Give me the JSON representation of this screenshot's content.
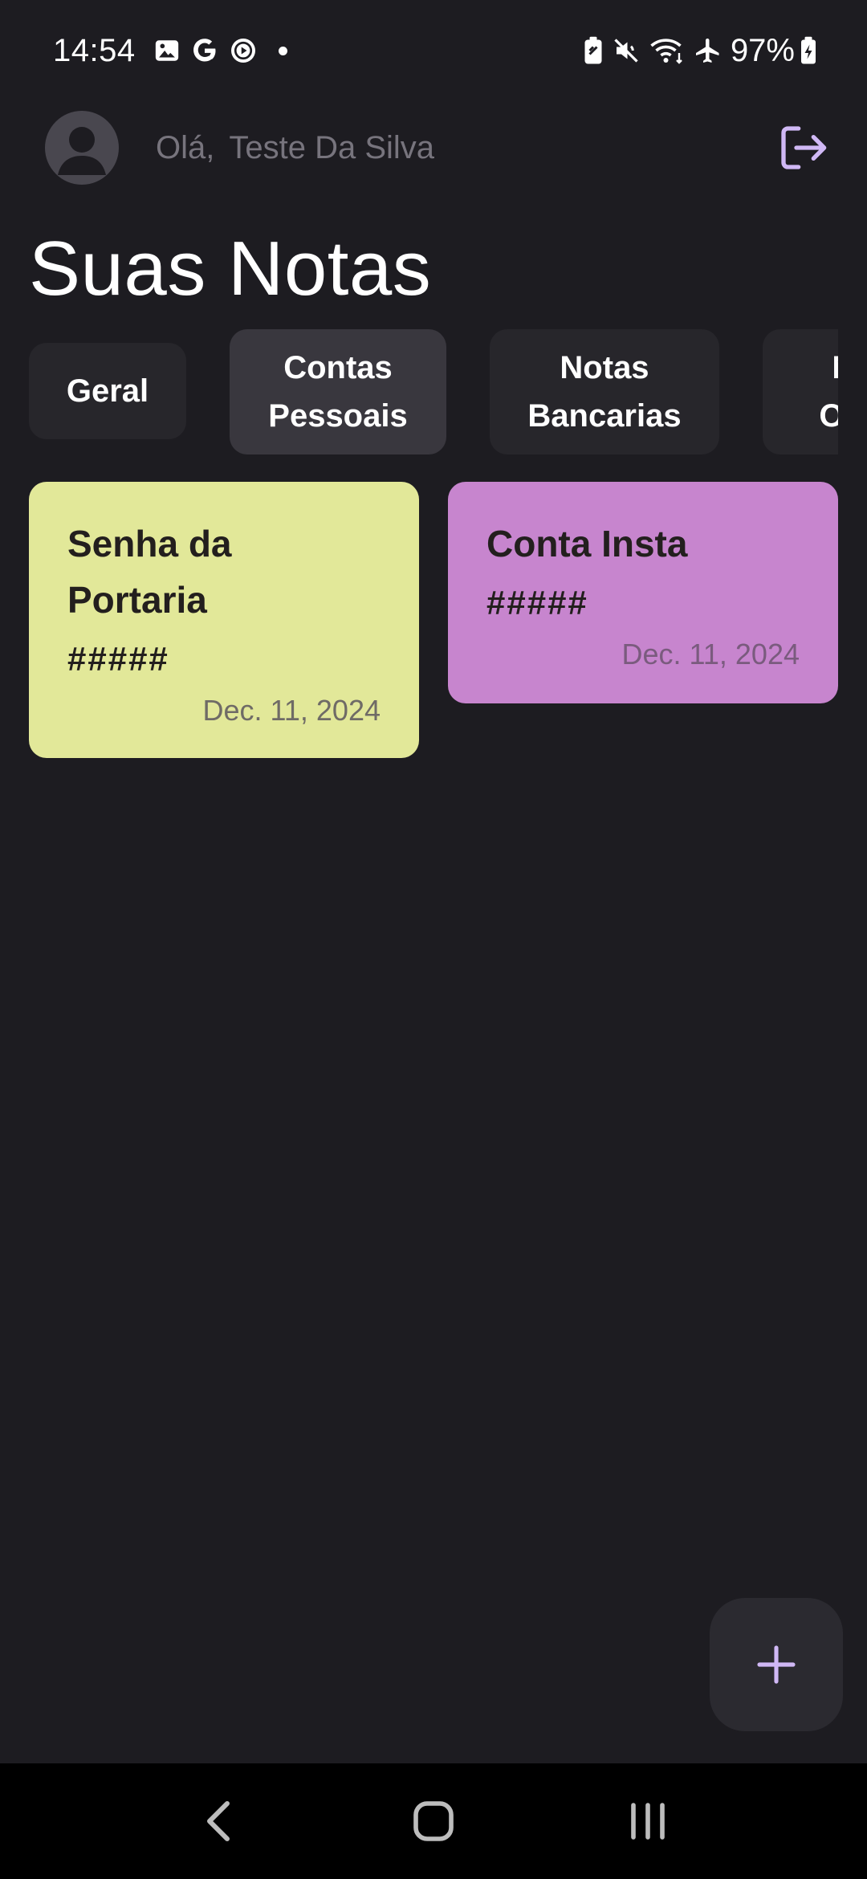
{
  "status_bar": {
    "time": "14:54",
    "battery_percent": "97%",
    "left_icons": [
      "gallery-icon",
      "google-icon",
      "play-icon",
      "dot-icon"
    ],
    "right_icons": [
      "battery-saver-icon",
      "mute-icon",
      "wifi-icon",
      "airplane-icon",
      "battery-icon"
    ]
  },
  "header": {
    "greeting_prefix": "Olá,",
    "user_name": "Teste Da Silva"
  },
  "page": {
    "title": "Suas Notas"
  },
  "categories": [
    {
      "line1": "Geral",
      "line2": "",
      "active": false
    },
    {
      "line1": "Contas",
      "line2": "Pessoais",
      "active": true
    },
    {
      "line1": "Notas",
      "line2": "Bancarias",
      "active": false
    },
    {
      "line1": "N",
      "line2": "Oc",
      "active": false
    }
  ],
  "notes": [
    {
      "title": "Senha da Portaria",
      "content": "#####",
      "date": "Dec. 11, 2024",
      "color": "#e2e899"
    },
    {
      "title": "Conta Insta",
      "content": "#####",
      "date": "Dec. 11, 2024",
      "color": "#c785ce"
    }
  ],
  "colors": {
    "background": "#1d1c21",
    "accent": "#d0b8f5",
    "tab_bg": "#27262b",
    "tab_active_bg": "#39373e"
  },
  "fab": {
    "icon": "plus-icon"
  },
  "nav_bar": {
    "buttons": [
      "back-icon",
      "home-icon",
      "recents-icon"
    ]
  }
}
